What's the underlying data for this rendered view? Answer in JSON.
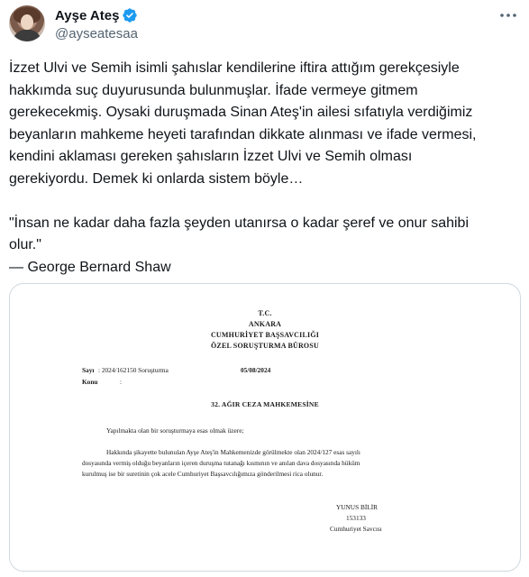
{
  "user": {
    "display_name": "Ayşe Ateş",
    "handle": "@ayseatesaa",
    "verified_color": "#1d9bf0"
  },
  "icons": {
    "verified": "verified-badge-icon",
    "more": "more-options-icon"
  },
  "tweet": {
    "text": "İzzet Ulvi ve Semih isimli şahıslar kendilerine iftira attığım gerekçesiyle\nhakkımda suç duyurusunda bulunmuşlar. İfade vermeye gitmem\ngerekecekmiş. Oysaki duruşmada Sinan Ateş'in ailesi sıfatıyla verdiğimiz\nbeyanların mahkeme heyeti tarafından dikkate alınması ve ifade vermesi,\nkendini aklaması gereken şahısların İzzet Ulvi ve Semih olması\ngerekiyordu. Demek ki onlarda sistem böyle…\n\n\"İnsan ne kadar daha fazla şeyden utanırsa o kadar şeref ve onur sahibi\nolur.\"\n— George Bernard Shaw"
  },
  "document": {
    "header": [
      "T.C.",
      "ANKARA",
      "CUMHURİYET BAŞSAVCILIĞI",
      "ÖZEL SORUŞTURMA BÜROSU"
    ],
    "sayi_label": "Sayı",
    "sayi_value": ": 2024/162150 Soruşturma",
    "date": "05/08/2024",
    "konu_label": "Konu",
    "konu_value": ":",
    "recipient": "32. AĞIR CEZA MAHKEMESİNE",
    "body_lines": [
      "Yapılmakta olan bir soruşturmaya esas olmak üzere;",
      "Hakkında şikayette bulunulan Ayşe Ateş'in Mahkemenizde görülmekte olan 2024/127 esas sayılı",
      "dosyasında vermiş olduğu beyanların içeren duruşma tutanağı kısmının ve anılan dava dosyasında hüküm",
      "kurulmuş ise bir suretinin çok acele Cumhuriyet Başsavcılığımıza gönderilmesi rica olunur."
    ],
    "signature": [
      "YUNUS BİLİR",
      "153133",
      "Cumhuriyet Savcısı"
    ]
  }
}
